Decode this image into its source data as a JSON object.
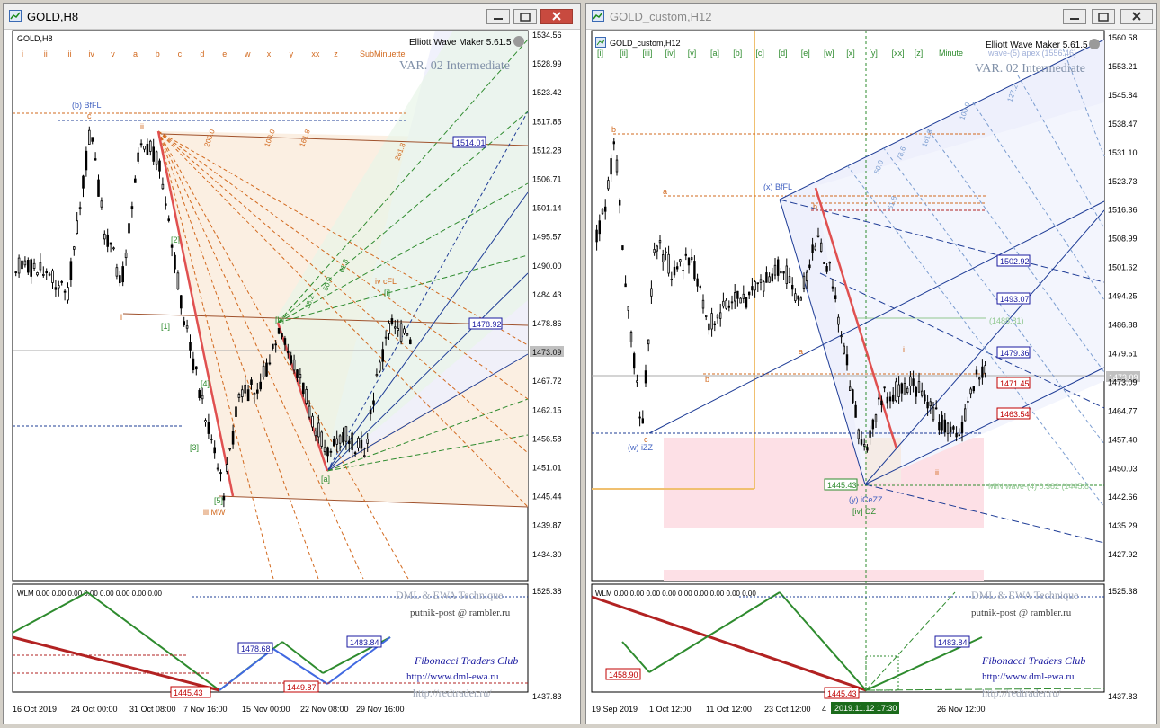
{
  "left": {
    "title": "GOLD,H8",
    "symbol_label": "GOLD,H8",
    "indicator_name": "Elliott Wave Maker 5.61.5",
    "var_label": "VAR. 02 Intermediate",
    "degree_label": "SubMinuette",
    "wave_menu": [
      "i",
      "ii",
      "iii",
      "iv",
      "v",
      "a",
      "b",
      "c",
      "d",
      "e",
      "w",
      "x",
      "y",
      "xx",
      "z"
    ],
    "price_ticks": [
      "1534.56",
      "1528.99",
      "1523.42",
      "1517.85",
      "1512.28",
      "1506.71",
      "1501.14",
      "1495.57",
      "1490.00",
      "1484.43",
      "1478.86",
      "1473.09",
      "1467.72",
      "1462.15",
      "1456.58",
      "1451.01",
      "1445.44",
      "1439.87",
      "1434.30"
    ],
    "sub_ticks": [
      "1525.38",
      "1437.83"
    ],
    "date_ticks": [
      "16 Oct 2019",
      "24 Oct 00:00",
      "31 Oct 08:00",
      "7 Nov 16:00",
      "15 Nov 00:00",
      "22 Nov 08:00",
      "29 Nov 16:00"
    ],
    "price_boxes": [
      "1514.01",
      "1478.92",
      "1473.09"
    ],
    "wave_labels": [
      "(b) BfFL",
      "c",
      "ii",
      "i",
      "[1]",
      "[2]",
      "[3]",
      "[4]",
      "[5]",
      "[b]",
      "iii MW",
      "iv cFL",
      "[i]",
      "[a]"
    ],
    "fib_labels": [
      "100.0",
      "161.8",
      "200.0",
      "261.8",
      "38.2",
      "50.0",
      "61.8"
    ],
    "wlm_label": "WLM 0.00 0.00 0.00 0.00 0.00 0.00 0.00 0.00",
    "sub_boxes": [
      "1478.68",
      "1483.84",
      "1449.87",
      "1445.43"
    ],
    "sub_texts": [
      "DML & EWA Technique",
      "putnik-post @ rambler.ru",
      "Fibonacci Traders Club",
      "http://www.dml-ewa.ru",
      "http://redtrader.ru/"
    ]
  },
  "right": {
    "title": "GOLD_custom,H12",
    "symbol_label": "GOLD_custom,H12",
    "indicator_name": "Elliott Wave Maker 5.61.5",
    "var_label": "VAR. 02 Intermediate",
    "degree_label": "Minute",
    "wave_menu": [
      "[i]",
      "[ii]",
      "[iii]",
      "[iv]",
      "[v]",
      "[a]",
      "[b]",
      "[c]",
      "[d]",
      "[e]",
      "[w]",
      "[x]",
      "[y]",
      "[xx]",
      "[z]"
    ],
    "price_ticks": [
      "1560.58",
      "1553.21",
      "1545.84",
      "1538.47",
      "1531.10",
      "1523.73",
      "1516.36",
      "1508.99",
      "1501.62",
      "1494.25",
      "1486.88",
      "1479.51",
      "1473.09",
      "1464.77",
      "1457.40",
      "1450.03",
      "1442.66",
      "1435.29",
      "1427.92"
    ],
    "sub_ticks": [
      "1525.38",
      "1437.83"
    ],
    "date_ticks": [
      "19 Sep 2019",
      "1 Oct 12:00",
      "11 Oct 12:00",
      "23 Oct 12:00",
      "4",
      "v 12:00",
      "26 Nov 12:00"
    ],
    "cursor_date": "2019.11.12 17:30",
    "price_boxes": [
      "1502.92",
      "1493.07",
      "1479.36",
      "1471.45",
      "1463.54",
      "1445.43",
      "1473.09"
    ],
    "text_labels": [
      "wave-(5) apex (1556.46)",
      "(1488.81)",
      "MIN wave-(4) 0.382 (1445.8"
    ],
    "wave_labels": [
      "b",
      "a",
      "c",
      "(w) iZZ",
      "(x) BfFL",
      "b",
      "a",
      "b",
      "(y) iCeZZ",
      "[iv] DZ",
      "i",
      "ii"
    ],
    "fib_labels": [
      "100.0",
      "127.2",
      "161.8",
      "50.0",
      "61.8",
      "78.6"
    ],
    "wlm_label": "WLM 0.00 0.00 0.00 0.00 0.00 0.00 0.00 0.00 0.00",
    "sub_boxes": [
      "1458.90",
      "1445.43",
      "1483.84"
    ],
    "sub_texts": [
      "DML & EWA Technique",
      "putnik-post @ rambler.ru",
      "Fibonacci Traders Club",
      "http://www.dml-ewa.ru",
      "http://redtrader.ru/"
    ]
  },
  "colors": {
    "bull_green": "#2e8b2e",
    "bear_red": "#b22222",
    "fib_orange": "#d2691e",
    "channel_blue": "#1e3c96",
    "price_box_blue": "#1a1aa0",
    "price_box_red": "#c00000",
    "zone_pink": "#fde0e6",
    "zone_blue": "#eef0fc",
    "zone_orange": "#fbefe2"
  }
}
